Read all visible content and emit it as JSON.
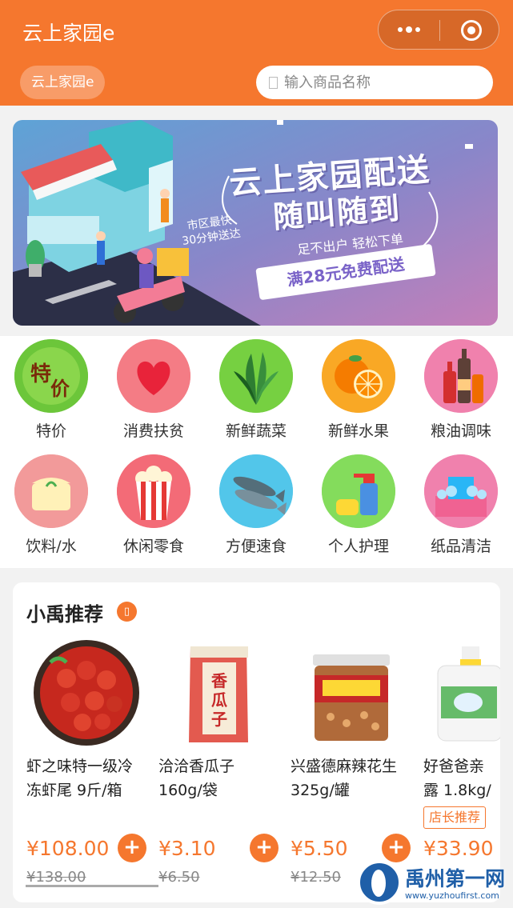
{
  "header": {
    "title": "云上家园e",
    "store_chip": "云上家园e",
    "search_placeholder": "输入商品名称",
    "accent_color": "#f5772e"
  },
  "banner": {
    "title_line1": "云上家园配送",
    "title_line2": "随叫随到",
    "tagline": "足不出户 轻松下单",
    "promo": "满28元免费配送",
    "speech_line1": "市区最快",
    "speech_line2": "30分钟送达"
  },
  "categories": [
    {
      "label": "特价",
      "icon": "special-price-icon"
    },
    {
      "label": "消费扶贫",
      "icon": "heart-icon"
    },
    {
      "label": "新鲜蔬菜",
      "icon": "vegetable-icon"
    },
    {
      "label": "新鲜水果",
      "icon": "orange-icon"
    },
    {
      "label": "粮油调味",
      "icon": "bottles-icon"
    },
    {
      "label": "饮料/水",
      "icon": "drink-icon"
    },
    {
      "label": "休闲零食",
      "icon": "popcorn-icon"
    },
    {
      "label": "方便速食",
      "icon": "fish-icon"
    },
    {
      "label": "个人护理",
      "icon": "spray-bottle-icon"
    },
    {
      "label": "纸品清洁",
      "icon": "laundry-icon"
    }
  ],
  "recommend": {
    "title": "小禹推荐",
    "products": [
      {
        "name_line1": "虾之味特一级冷",
        "name_line2": "冻虾尾 9斤/箱",
        "price": "¥108.00",
        "orig": "¥138.00",
        "tag": ""
      },
      {
        "name_line1": "洽洽香瓜子",
        "name_line2": "160g/袋",
        "price": "¥3.10",
        "orig": "¥6.50",
        "tag": ""
      },
      {
        "name_line1": "兴盛德麻辣花生",
        "name_line2": "325g/罐",
        "price": "¥5.50",
        "orig": "¥12.50",
        "tag": ""
      },
      {
        "name_line1": "好爸爸亲",
        "name_line2": "露 1.8kg/",
        "price": "¥33.90",
        "orig": "",
        "tag": "店长推荐"
      }
    ]
  },
  "watermark": {
    "name": "禹州第一网",
    "url": "www.yuzhoufirst.com"
  }
}
